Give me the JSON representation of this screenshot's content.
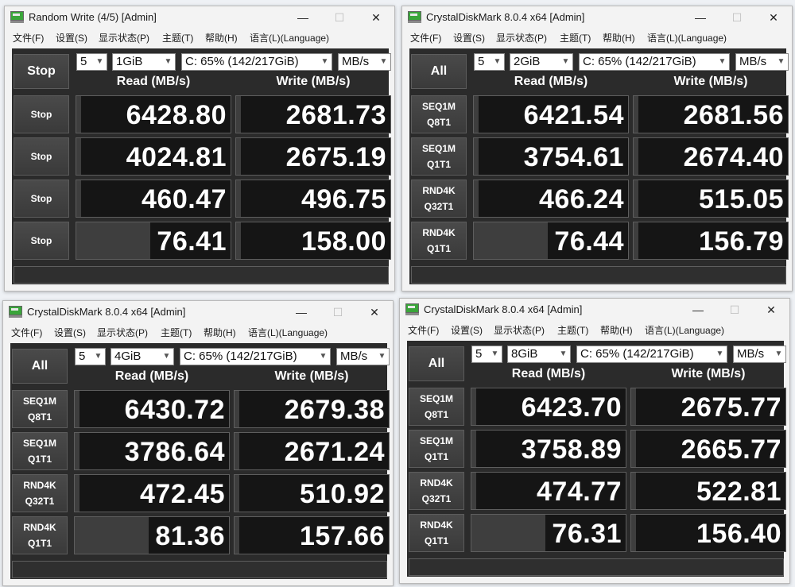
{
  "menu": [
    "文件(F)",
    "设置(S)",
    "显示状态(P)",
    "主题(T)",
    "帮助(H)",
    "语言(L)(Language)"
  ],
  "column_headers": {
    "read": "Read (MB/s)",
    "write": "Write (MB/s)"
  },
  "window_controls": {
    "minimize": "—",
    "maximize": "☐",
    "close": "✕"
  },
  "windows": [
    {
      "title": "Random Write (4/5) [Admin]",
      "main_button": "Stop",
      "count": "5",
      "size": "1GiB",
      "drive": "C: 65% (142/217GiB)",
      "unit": "MB/s",
      "rows": [
        {
          "label1": "Stop",
          "label2": "",
          "read": "6428.80",
          "write": "2681.73",
          "read_fill": 0.97,
          "write_fill": 0.97
        },
        {
          "label1": "Stop",
          "label2": "",
          "read": "4024.81",
          "write": "2675.19",
          "read_fill": 0.97,
          "write_fill": 0.97
        },
        {
          "label1": "Stop",
          "label2": "",
          "read": "460.47",
          "write": "496.75",
          "read_fill": 0.97,
          "write_fill": 0.97
        },
        {
          "label1": "Stop",
          "label2": "",
          "read": "76.41",
          "write": "158.00",
          "read_fill": 0.52,
          "write_fill": 0.97
        }
      ]
    },
    {
      "title": "CrystalDiskMark 8.0.4 x64 [Admin]",
      "main_button": "All",
      "count": "5",
      "size": "2GiB",
      "drive": "C: 65% (142/217GiB)",
      "unit": "MB/s",
      "rows": [
        {
          "label1": "SEQ1M",
          "label2": "Q8T1",
          "read": "6421.54",
          "write": "2681.56",
          "read_fill": 0.97,
          "write_fill": 0.97
        },
        {
          "label1": "SEQ1M",
          "label2": "Q1T1",
          "read": "3754.61",
          "write": "2674.40",
          "read_fill": 0.97,
          "write_fill": 0.97
        },
        {
          "label1": "RND4K",
          "label2": "Q32T1",
          "read": "466.24",
          "write": "515.05",
          "read_fill": 0.97,
          "write_fill": 0.97
        },
        {
          "label1": "RND4K",
          "label2": "Q1T1",
          "read": "76.44",
          "write": "156.79",
          "read_fill": 0.52,
          "write_fill": 0.97
        }
      ]
    },
    {
      "title": "CrystalDiskMark 8.0.4 x64 [Admin]",
      "main_button": "All",
      "count": "5",
      "size": "4GiB",
      "drive": "C: 65% (142/217GiB)",
      "unit": "MB/s",
      "rows": [
        {
          "label1": "SEQ1M",
          "label2": "Q8T1",
          "read": "6430.72",
          "write": "2679.38",
          "read_fill": 0.97,
          "write_fill": 0.97
        },
        {
          "label1": "SEQ1M",
          "label2": "Q1T1",
          "read": "3786.64",
          "write": "2671.24",
          "read_fill": 0.97,
          "write_fill": 0.97
        },
        {
          "label1": "RND4K",
          "label2": "Q32T1",
          "read": "472.45",
          "write": "510.92",
          "read_fill": 0.97,
          "write_fill": 0.97
        },
        {
          "label1": "RND4K",
          "label2": "Q1T1",
          "read": "81.36",
          "write": "157.66",
          "read_fill": 0.52,
          "write_fill": 0.97
        }
      ]
    },
    {
      "title": "CrystalDiskMark 8.0.4 x64 [Admin]",
      "main_button": "All",
      "count": "5",
      "size": "8GiB",
      "drive": "C: 65% (142/217GiB)",
      "unit": "MB/s",
      "rows": [
        {
          "label1": "SEQ1M",
          "label2": "Q8T1",
          "read": "6423.70",
          "write": "2675.77",
          "read_fill": 0.97,
          "write_fill": 0.97
        },
        {
          "label1": "SEQ1M",
          "label2": "Q1T1",
          "read": "3758.89",
          "write": "2665.77",
          "read_fill": 0.97,
          "write_fill": 0.97
        },
        {
          "label1": "RND4K",
          "label2": "Q32T1",
          "read": "474.77",
          "write": "522.81",
          "read_fill": 0.97,
          "write_fill": 0.97
        },
        {
          "label1": "RND4K",
          "label2": "Q1T1",
          "read": "76.31",
          "write": "156.40",
          "read_fill": 0.52,
          "write_fill": 0.97
        }
      ]
    }
  ]
}
